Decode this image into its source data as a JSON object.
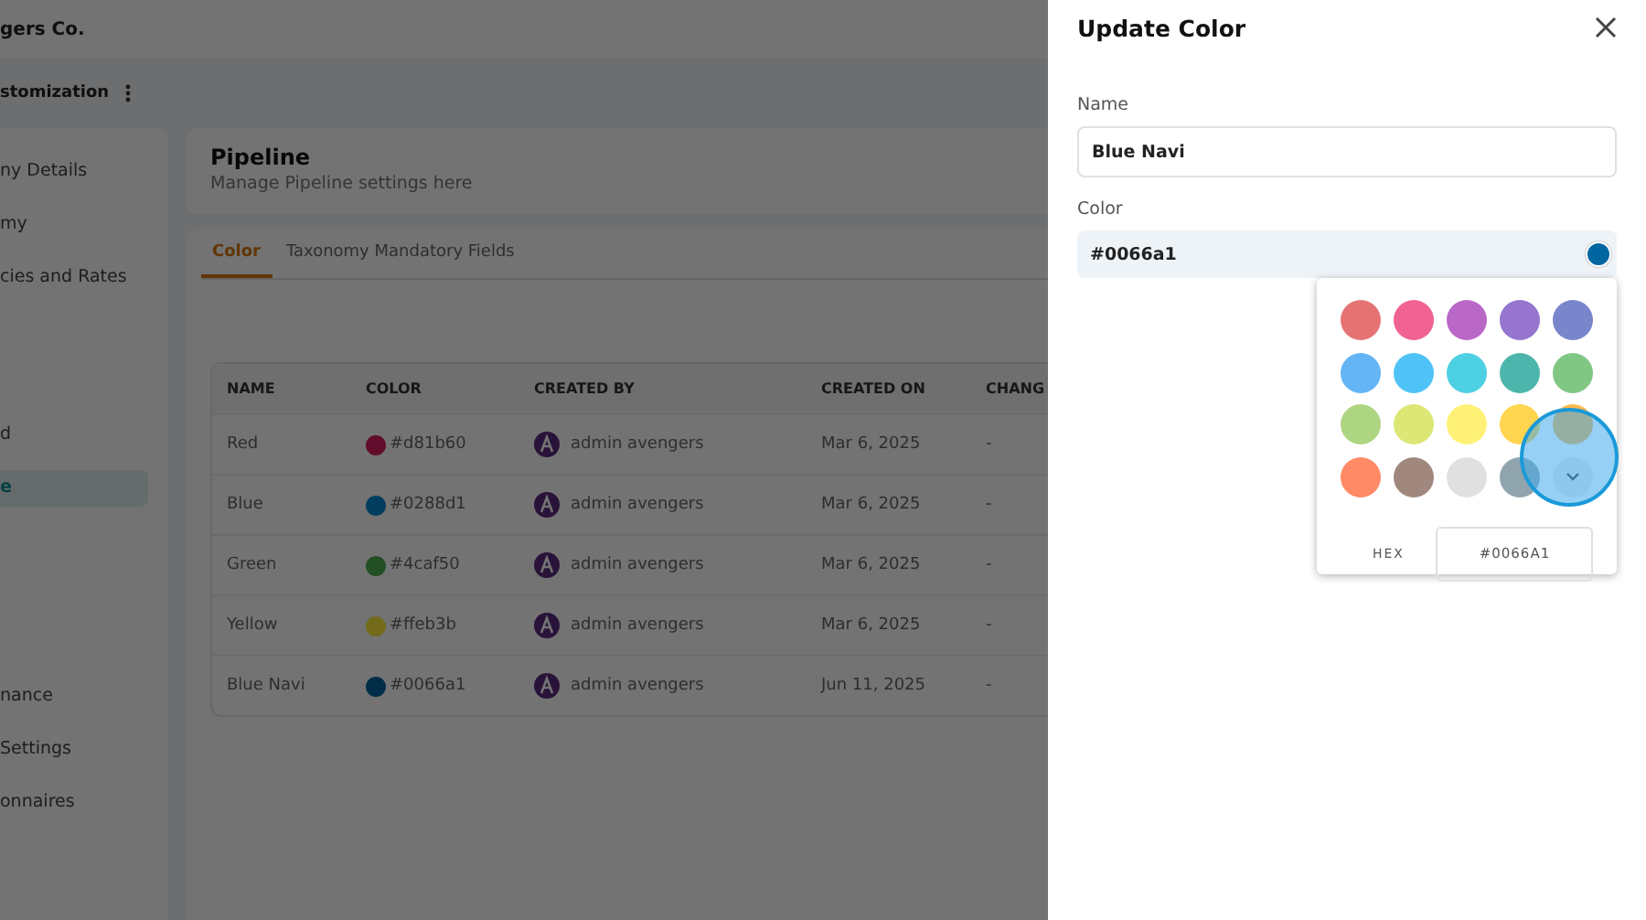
{
  "app": {
    "company": "gers Co.",
    "section": "stomization"
  },
  "sidebar": {
    "groups": [
      [
        {
          "label": "ny Details",
          "selected": false
        },
        {
          "label": "my",
          "selected": false
        },
        {
          "label": "cies and Rates",
          "selected": false
        }
      ],
      [
        {
          "label": "d",
          "selected": false
        },
        {
          "label": "e",
          "selected": true
        }
      ],
      [
        {
          "label": "nance",
          "selected": false
        },
        {
          "label": "Settings",
          "selected": false
        },
        {
          "label": "onnaires",
          "selected": false
        }
      ]
    ]
  },
  "page": {
    "title": "Pipeline",
    "subtitle": "Manage Pipeline settings here"
  },
  "tabs": [
    {
      "label": "Color",
      "selected": true
    },
    {
      "label": "Taxonomy Mandatory Fields",
      "selected": false
    }
  ],
  "table": {
    "columns": [
      "NAME",
      "COLOR",
      "CREATED BY",
      "CREATED ON",
      "CHANG"
    ],
    "rows": [
      {
        "name": "Red",
        "color": "#610c2b",
        "hex": "#d81b60",
        "created_by": "admin avengers",
        "created_on": "Mar 6, 2025",
        "changed": "-"
      },
      {
        "name": "Blue",
        "color": "#013d5e",
        "hex": "#0288d1",
        "created_by": "admin avengers",
        "created_on": "Mar 6, 2025",
        "changed": "-"
      },
      {
        "name": "Green",
        "color": "#224f24",
        "hex": "#4caf50",
        "created_by": "admin avengers",
        "created_on": "Mar 6, 2025",
        "changed": "-"
      },
      {
        "name": "Yellow",
        "color": "#736a1b",
        "hex": "#ffeb3b",
        "created_by": "admin avengers",
        "created_on": "Mar 6, 2025",
        "changed": "-"
      },
      {
        "name": "Blue Navi",
        "color": "#002e48",
        "hex": "#0066a1",
        "created_by": "admin avengers",
        "created_on": "Jun 11, 2025",
        "changed": "-"
      }
    ]
  },
  "drawer": {
    "title": "Update Color",
    "name_field": {
      "label": "Name",
      "value": "Blue Navi"
    },
    "color_field": {
      "label": "Color",
      "value": "#0066a1",
      "color": "#0066a1"
    },
    "picker": {
      "swatches": [
        {
          "color": "#e57373"
        },
        {
          "color": "#f06292"
        },
        {
          "color": "#ba68c8"
        },
        {
          "color": "#9575cd"
        },
        {
          "color": "#7986cb"
        },
        {
          "color": "#64b5f6"
        },
        {
          "color": "#4fc3f7"
        },
        {
          "color": "#4dd0e1"
        },
        {
          "color": "#4db6ac"
        },
        {
          "color": "#81c784"
        },
        {
          "color": "#aed581"
        },
        {
          "color": "#dce775"
        },
        {
          "color": "#fff176"
        },
        {
          "color": "#ffd54f"
        },
        {
          "color": "#ffb74d"
        },
        {
          "color": "#ff8a65"
        },
        {
          "color": "#a1887f"
        },
        {
          "color": "#e0e0e0"
        },
        {
          "color": "#90a4ae"
        }
      ],
      "hex_label": "HEX",
      "hex_value": "#0066A1"
    }
  }
}
